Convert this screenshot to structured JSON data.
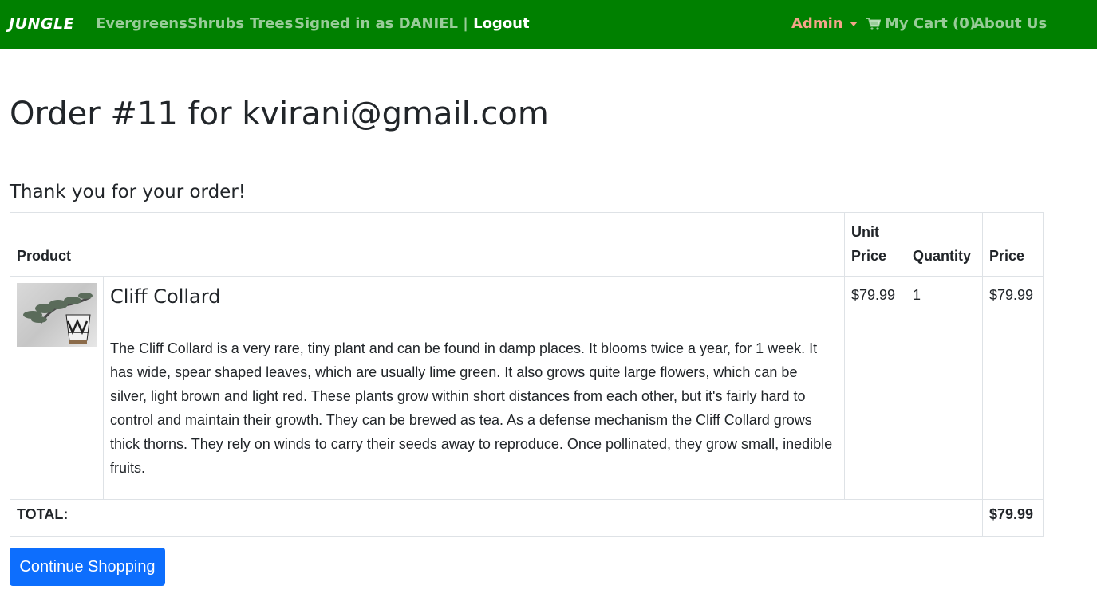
{
  "nav": {
    "brand": "JUNGLE",
    "links": [
      "Evergreens",
      "Shrubs",
      "Trees"
    ],
    "signed_in_prefix": "Signed in as DANIEL |",
    "logout": "Logout",
    "admin": "Admin",
    "cart": "My Cart (0)",
    "about": "About Us"
  },
  "page": {
    "title": "Order #11 for kvirani@gmail.com",
    "thanks": "Thank you for your order!"
  },
  "table": {
    "headers": {
      "product": "Product",
      "unit_price_line1": "Unit",
      "unit_price_line2": "Price",
      "quantity": "Quantity",
      "price": "Price"
    },
    "rows": [
      {
        "name": "Cliff Collard",
        "description": "The Cliff Collard is a very rare, tiny plant and can be found in damp places. It blooms twice a year, for 1 week. It has wide, spear shaped leaves, which are usually lime green. It also grows quite large flowers, which can be silver, light brown and light red. These plants grow within short distances from each other, but it's fairly hard to control and maintain their growth. They can be brewed as tea. As a defense mechanism the Cliff Collard grows thick thorns. They rely on winds to carry their seeds away to reproduce. Once pollinated, they grow small, inedible fruits.",
        "unit_price": "$79.99",
        "quantity": "1",
        "price": "$79.99"
      }
    ],
    "total_label": "TOTAL:",
    "total_value": "$79.99"
  },
  "buttons": {
    "continue": "Continue Shopping"
  },
  "colors": {
    "navbar": "#008000",
    "admin": "#f4a58a",
    "primary_button": "#0d6efd"
  }
}
